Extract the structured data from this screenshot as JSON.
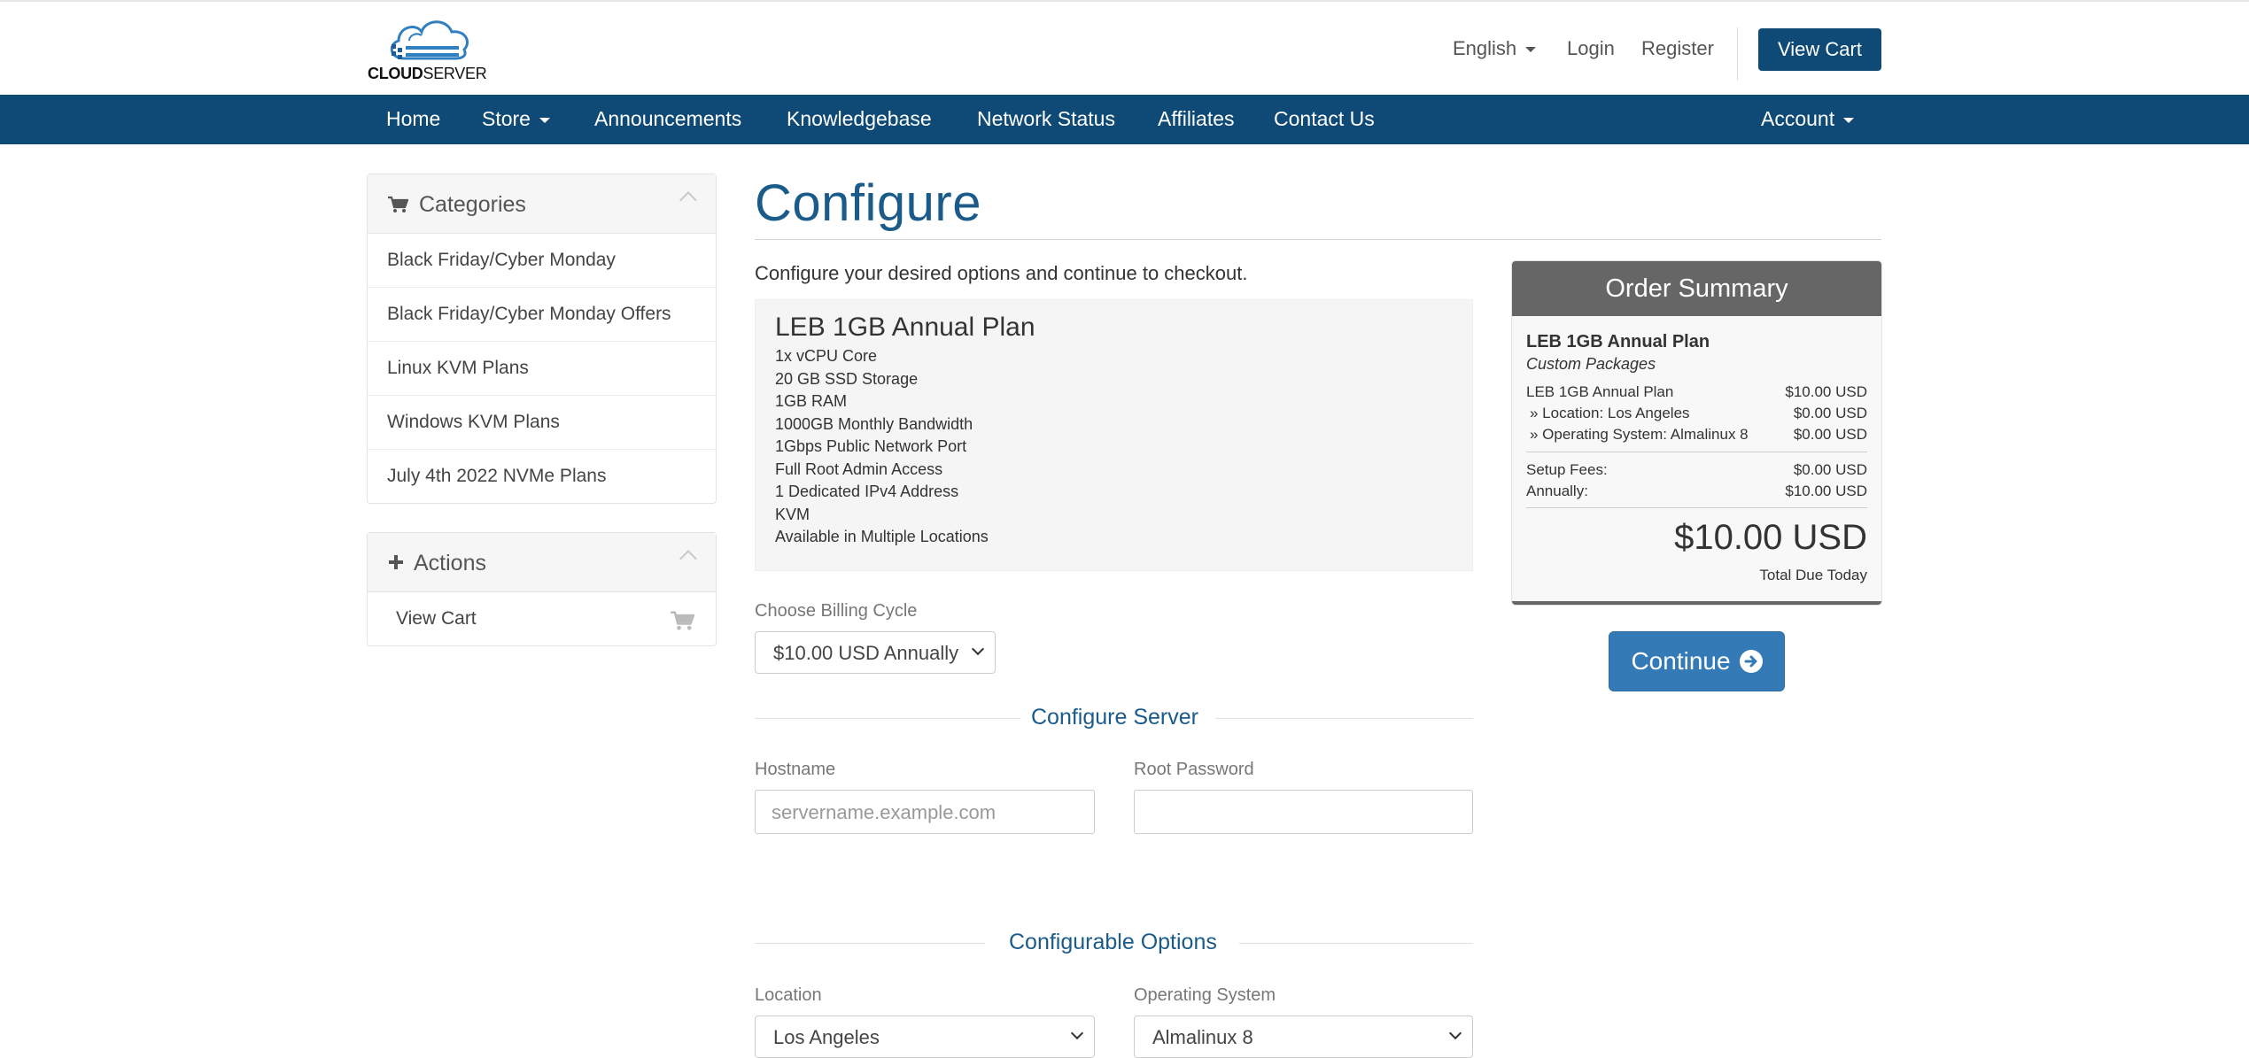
{
  "brand": {
    "logo_bold": "CLOUD",
    "logo_light": "SERVER"
  },
  "header": {
    "language": "English",
    "login": "Login",
    "register": "Register",
    "view_cart": "View Cart"
  },
  "nav": {
    "home": "Home",
    "store": "Store",
    "announcements": "Announcements",
    "knowledgebase": "Knowledgebase",
    "network_status": "Network Status",
    "affiliates": "Affiliates",
    "contact_us": "Contact Us",
    "account": "Account"
  },
  "sidebar": {
    "categories_title": "Categories",
    "categories": [
      {
        "label": "Black Friday/Cyber Monday"
      },
      {
        "label": "Black Friday/Cyber Monday Offers"
      },
      {
        "label": "Linux KVM Plans"
      },
      {
        "label": "Windows KVM Plans"
      },
      {
        "label": "July 4th 2022 NVMe Plans"
      }
    ],
    "actions_title": "Actions",
    "actions": [
      {
        "label": "View Cart"
      }
    ]
  },
  "main": {
    "title": "Configure",
    "intro": "Configure your desired options and continue to checkout.",
    "product": {
      "name": "LEB 1GB Annual Plan",
      "features": [
        "1x vCPU Core",
        "20 GB SSD Storage",
        "1GB RAM",
        "1000GB Monthly Bandwidth",
        "1Gbps Public Network Port",
        "Full Root Admin Access",
        "1 Dedicated IPv4 Address",
        "KVM",
        "Available in Multiple Locations"
      ]
    },
    "billing_cycle_label": "Choose Billing Cycle",
    "billing_cycle_value": "$10.00 USD Annually",
    "configure_server_heading": "Configure Server",
    "hostname_label": "Hostname",
    "hostname_placeholder": "servername.example.com",
    "root_password_label": "Root Password",
    "root_password_value": "",
    "configurable_options_heading": "Configurable Options",
    "location_label": "Location",
    "location_value": "Los Angeles",
    "os_label": "Operating System",
    "os_value": "Almalinux 8"
  },
  "summary": {
    "title": "Order Summary",
    "product_name": "LEB 1GB Annual Plan",
    "product_group": "Custom Packages",
    "lines": [
      {
        "label": "LEB 1GB Annual Plan",
        "amount": "$10.00 USD"
      },
      {
        "label": "» Location: Los Angeles",
        "amount": "$0.00 USD"
      },
      {
        "label": "» Operating System: Almalinux 8",
        "amount": "$0.00 USD"
      }
    ],
    "setup_fees_label": "Setup Fees:",
    "setup_fees": "$0.00 USD",
    "annually_label": "Annually:",
    "annually": "$10.00 USD",
    "total": "$10.00 USD",
    "total_label": "Total Due Today"
  },
  "continue_button": "Continue",
  "colors": {
    "brand_blue": "#0e4a75",
    "heading_blue": "#1a5b8a",
    "button_blue": "#337ab7",
    "summary_gray": "#666666"
  }
}
